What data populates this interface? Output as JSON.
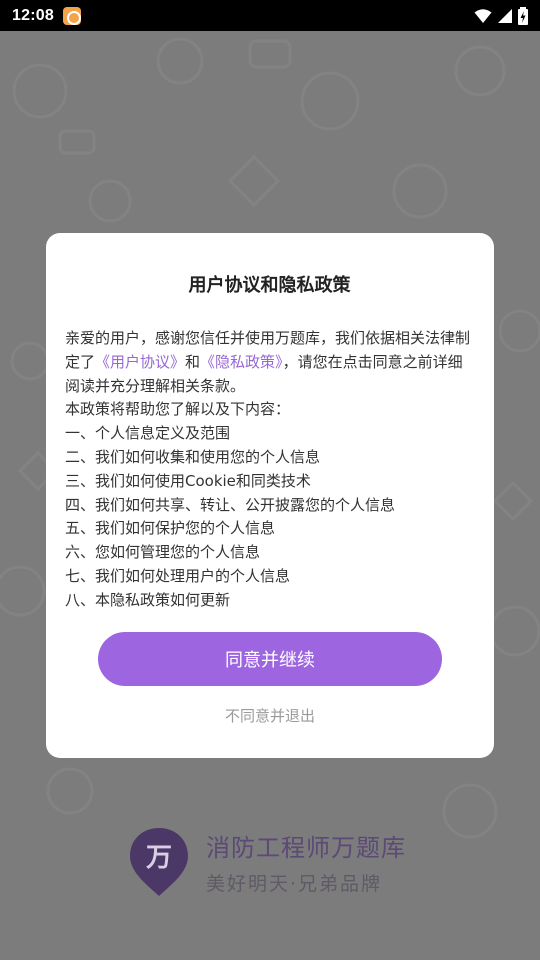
{
  "status_bar": {
    "time": "12:08",
    "icons": [
      "app-notification-icon",
      "wifi-icon",
      "signal-icon",
      "battery-charging-icon"
    ]
  },
  "dialog": {
    "title": "用户协议和隐私政策",
    "intro_prefix": "亲爱的用户，感谢您信任并使用万题库，我们依据相关法律制定了",
    "user_agreement_link": "《用户协议》",
    "and_text": "和",
    "privacy_link": "《隐私政策》",
    "intro_suffix": "，请您在点击同意之前详细阅读并充分理解相关条款。",
    "lead": "本政策将帮助您了解以及下内容：",
    "items": [
      "一、个人信息定义及范围",
      "二、我们如何收集和使用您的个人信息",
      "三、我们如何使用Cookie和同类技术",
      "四、我们如何共享、转让、公开披露您的个人信息",
      "五、我们如何保护您的个人信息",
      "六、您如何管理您的个人信息",
      "七、我们如何处理用户的个人信息",
      "八、本隐私政策如何更新"
    ],
    "agree_button": "同意并继续",
    "decline_button": "不同意并退出"
  },
  "brand": {
    "logo_char": "万",
    "title": "消防工程师万题库",
    "slogan": "美好明天·兄弟品牌"
  },
  "colors": {
    "accent": "#9d66e0",
    "link": "#9767d6",
    "overlay": "#7c7c7c"
  }
}
